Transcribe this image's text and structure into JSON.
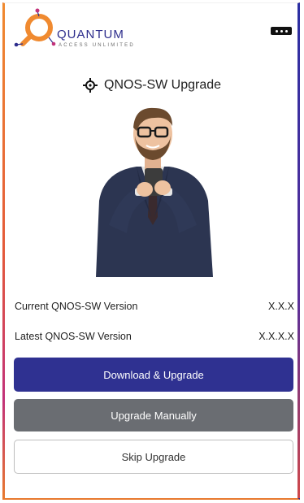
{
  "brand": {
    "name": "QUANTUM",
    "tagline": "ACCESS UNLIMITED",
    "colors": {
      "orange": "#f08a30",
      "navy": "#2d2d8c",
      "primary_button": "#2f3191",
      "secondary_button": "#6a6d72"
    }
  },
  "header": {
    "menu_icon": "ellipsis-icon"
  },
  "page": {
    "title": "QNOS-SW Upgrade",
    "title_icon": "crosshair-icon"
  },
  "versions": [
    {
      "label": "Current QNOS-SW Version",
      "value": "X.X.X"
    },
    {
      "label": "Latest QNOS-SW Version",
      "value": "X.X.X.X"
    }
  ],
  "actions": {
    "download_label": "Download & Upgrade",
    "manual_label": "Upgrade Manually",
    "skip_label": "Skip Upgrade"
  }
}
